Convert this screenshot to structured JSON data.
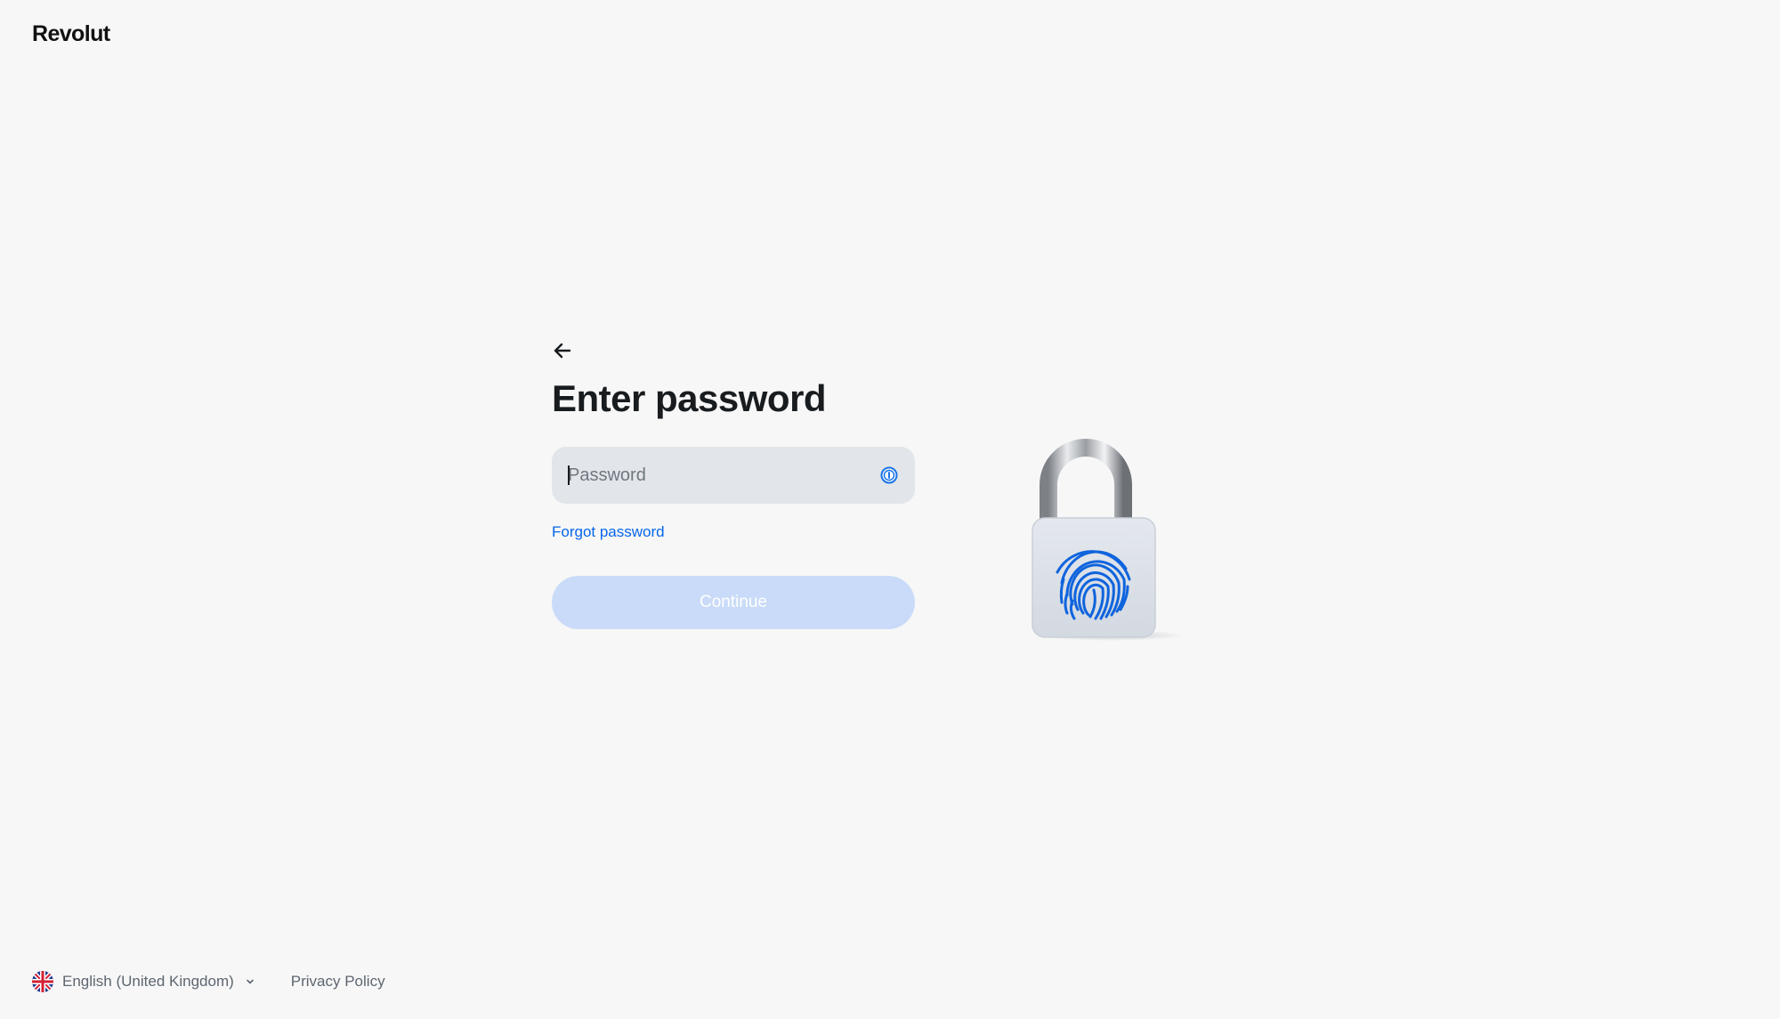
{
  "brand": {
    "logo_text": "Revolut"
  },
  "back_button": {
    "icon": "arrow-left-icon"
  },
  "form": {
    "title": "Enter password",
    "password_placeholder": "Password",
    "password_value": "",
    "password_manager_icon": "password-manager-icon",
    "forgot_label": "Forgot password",
    "continue_label": "Continue"
  },
  "illustration": {
    "icon": "fingerprint-padlock-icon"
  },
  "footer": {
    "language_label": "English (United Kingdom)",
    "language_flag_icon": "uk-flag-icon",
    "privacy_label": "Privacy Policy"
  },
  "colors": {
    "background": "#f7f7f7",
    "accent": "#0666eb",
    "input_bg": "#e2e5e9",
    "button_disabled_bg": "#c9dbf8"
  }
}
